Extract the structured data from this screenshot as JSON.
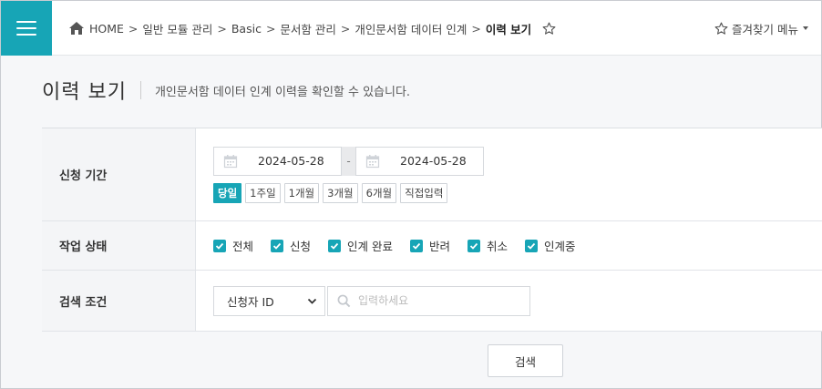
{
  "breadcrumb": {
    "items": [
      "HOME",
      "일반 모듈 관리",
      "Basic",
      "문서함 관리",
      "개인문서함 데이터 인계"
    ],
    "separator": ">",
    "current": "이력 보기"
  },
  "favorites": {
    "label": "즐겨찾기 메뉴"
  },
  "page": {
    "title": "이력 보기",
    "description": "개인문서함 데이터 인계 이력을 확인할 수 있습니다."
  },
  "form": {
    "period": {
      "label": "신청 기간",
      "start_date": "2024-05-28",
      "dash": "-",
      "end_date": "2024-05-28",
      "quick_buttons": [
        "당일",
        "1주일",
        "1개월",
        "3개월",
        "6개월",
        "직접입력"
      ],
      "active_quick": "당일"
    },
    "status": {
      "label": "작업 상태",
      "options": [
        {
          "label": "전체",
          "checked": true
        },
        {
          "label": "신청",
          "checked": true
        },
        {
          "label": "인계 완료",
          "checked": true
        },
        {
          "label": "반려",
          "checked": true
        },
        {
          "label": "취소",
          "checked": true
        },
        {
          "label": "인계중",
          "checked": true
        }
      ]
    },
    "search": {
      "label": "검색 조건",
      "select_value": "신청자 ID",
      "placeholder": "입력하세요"
    }
  },
  "actions": {
    "search_label": "검색"
  },
  "colors": {
    "accent": "#17a5b6",
    "border": "#d6d9dd",
    "header_bg": "#f4f5f7"
  }
}
